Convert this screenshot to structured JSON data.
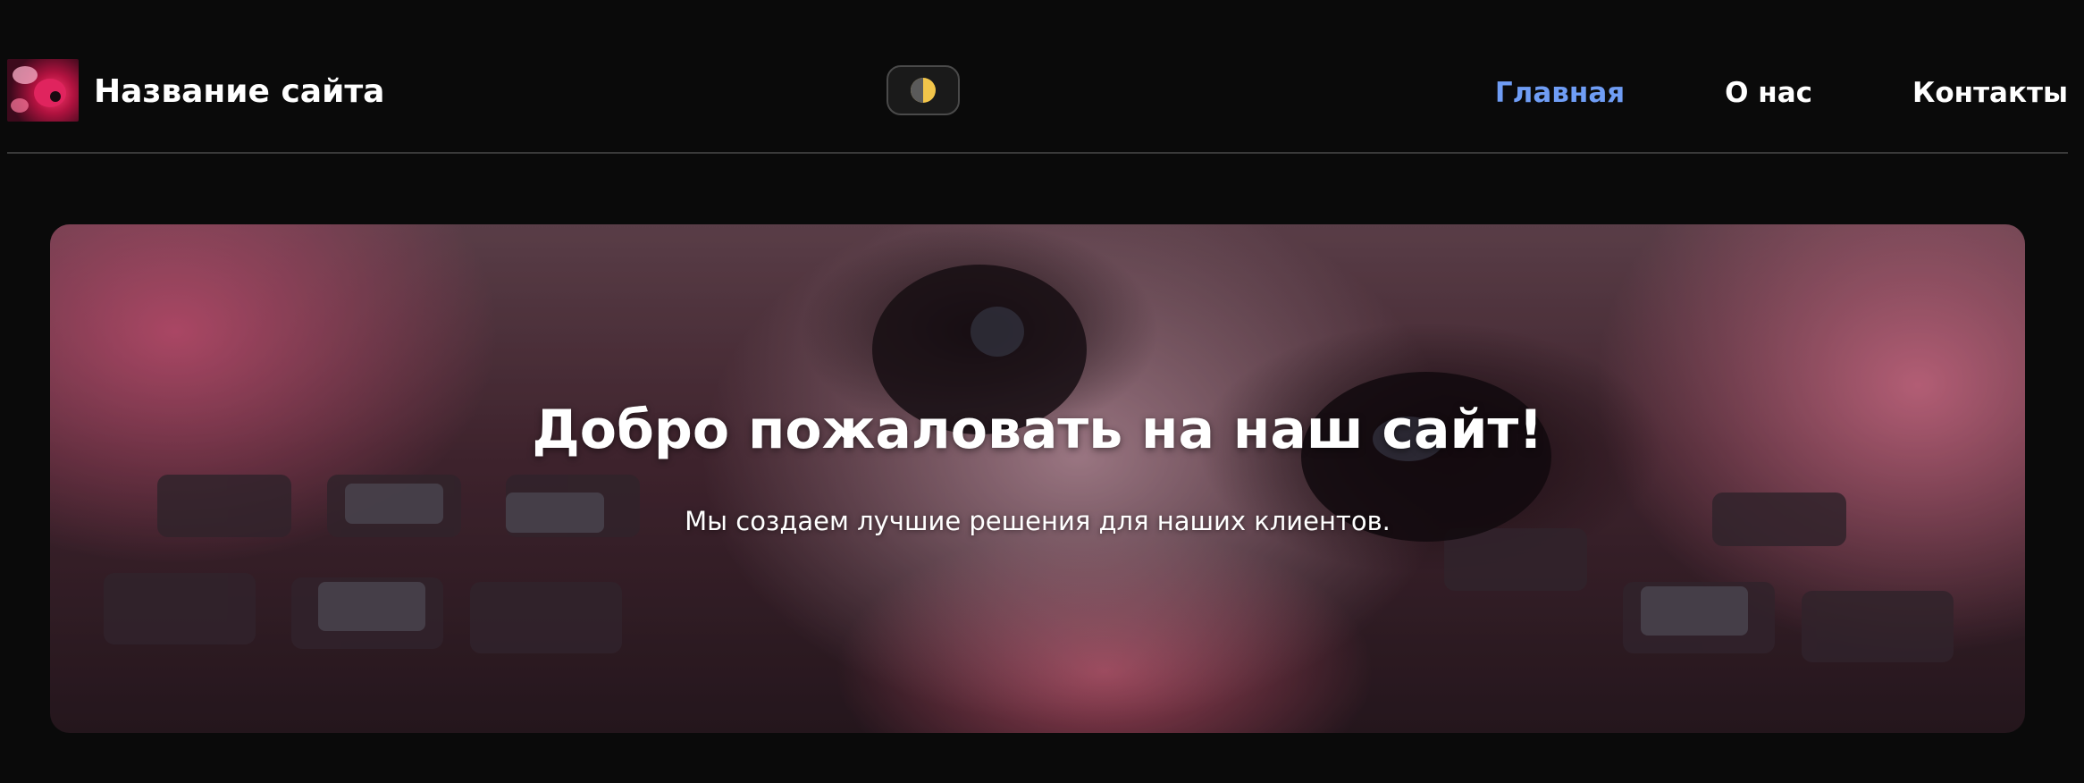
{
  "header": {
    "site_title": "Название сайта",
    "logo_icon": "cat-logo-icon",
    "theme_toggle_icon": "half-moon-icon",
    "nav": [
      {
        "label": "Главная",
        "active": true
      },
      {
        "label": "О нас",
        "active": false
      },
      {
        "label": "Контакты",
        "active": false
      }
    ]
  },
  "hero": {
    "title": "Добро пожаловать на наш сайт!",
    "subtitle": "Мы создаем лучшие решения для наших клиентов."
  },
  "colors": {
    "background": "#0a0a0a",
    "accent": "#6f9df5",
    "text": "#ffffff"
  }
}
